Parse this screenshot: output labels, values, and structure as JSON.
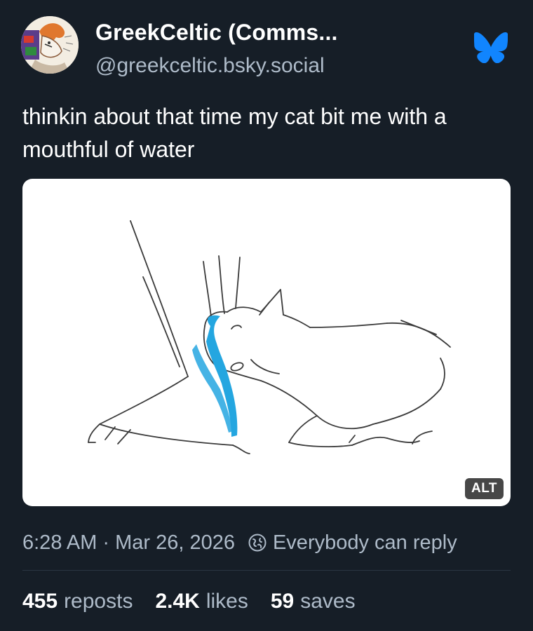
{
  "author": {
    "display_name": "GreekCeltic (Comms...",
    "handle": "@greekceltic.bsky.social",
    "avatar_icon": "avatar-illustration"
  },
  "platform_icon": "bluesky-butterfly-icon",
  "colors": {
    "background": "#161e27",
    "accent": "#1185fe",
    "muted_text": "#aebbc9",
    "water": "#24a6e0"
  },
  "post": {
    "text": "thinkin about that time my cat bit me with a mouthful of water",
    "image": {
      "alt_badge": "ALT"
    }
  },
  "meta": {
    "time": "6:28 AM",
    "separator": "·",
    "date": "Mar 26, 2026",
    "reply_setting": "Everybody can reply",
    "reply_icon": "globe-icon"
  },
  "stats": [
    {
      "count": "455",
      "label": "reposts"
    },
    {
      "count": "2.4K",
      "label": "likes"
    },
    {
      "count": "59",
      "label": "saves"
    }
  ]
}
